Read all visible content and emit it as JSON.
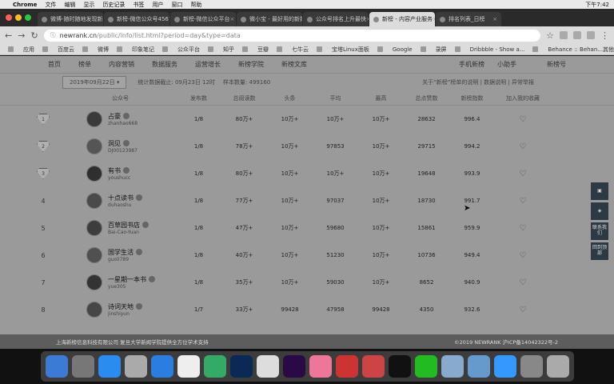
{
  "menubar": {
    "apple": "",
    "app": "Chrome",
    "items": [
      "文件",
      "编辑",
      "显示",
      "历史记录",
      "书签",
      "用户",
      "窗口",
      "帮助"
    ],
    "clock": "下午7:42"
  },
  "tabs": [
    {
      "label": "微博-随时随地发现新",
      "active": false
    },
    {
      "label": "新榜-微信公众号4567",
      "active": false
    },
    {
      "label": "新榜-微信公众平台",
      "active": false
    },
    {
      "label": "微小宝 - 最好用的新媒",
      "active": false
    },
    {
      "label": "公众号排名上升最快",
      "active": false
    },
    {
      "label": "新榜 - 内容产业服务",
      "active": true
    },
    {
      "label": "排名列表_日榜",
      "active": false
    }
  ],
  "address": {
    "host": "newrank.cn",
    "path": "/public/info/list.html?period=day&type=data"
  },
  "bookmarks": [
    "应用",
    "百度云",
    "微博",
    "印象笔记",
    "公众平台",
    "知乎",
    "豆瓣",
    "七牛云",
    "宝塔Linux面板",
    "Google",
    "录屏",
    "Dribbble - Show a...",
    "Behance :: Behan..."
  ],
  "bookmarks_other": "其他书签",
  "sitenav": {
    "items": [
      "首页",
      "榜单",
      "内容营销",
      "数据服务",
      "运营增长",
      "新榜学院",
      "新榜文库"
    ],
    "right": [
      "手机新榜",
      "小助手",
      "新榜号"
    ]
  },
  "filter": {
    "date": "2019年09月22日",
    "stat_time": "统计数据截止: 09月23日 12时",
    "sample": "样本数量: 499160",
    "links": "关于“新榜”榜单的说明 | 数据说明 | 异常举报"
  },
  "table": {
    "headers": [
      "",
      "公众号",
      "发布数",
      "总阅读数",
      "头条",
      "平均",
      "最高",
      "总点赞数",
      "新榜指数",
      "加入我的收藏"
    ],
    "rows": [
      {
        "rank": "1",
        "medal": true,
        "name": "占豪",
        "id": "zhanhao668",
        "posts": "1/8",
        "total": "80万+",
        "head": "10万+",
        "avg": "10万+",
        "max": "10万+",
        "likes": "28632",
        "index": "996.4"
      },
      {
        "rank": "2",
        "medal": true,
        "name": "洞见",
        "id": "DJ00123987",
        "posts": "1/8",
        "total": "78万+",
        "head": "10万+",
        "avg": "97853",
        "max": "10万+",
        "likes": "29715",
        "index": "994.2"
      },
      {
        "rank": "3",
        "medal": true,
        "name": "有书",
        "id": "youshucc",
        "posts": "1/8",
        "total": "80万+",
        "head": "10万+",
        "avg": "10万+",
        "max": "10万+",
        "likes": "19648",
        "index": "993.9"
      },
      {
        "rank": "4",
        "medal": false,
        "name": "十点读书",
        "id": "duhaoshu",
        "posts": "1/8",
        "total": "77万+",
        "head": "10万+",
        "avg": "97037",
        "max": "10万+",
        "likes": "18730",
        "index": "991.7"
      },
      {
        "rank": "5",
        "medal": false,
        "name": "百草园书店",
        "id": "Bai-Cao-Yuan",
        "posts": "1/8",
        "total": "47万+",
        "head": "10万+",
        "avg": "59680",
        "max": "10万+",
        "likes": "15861",
        "index": "959.9"
      },
      {
        "rank": "6",
        "medal": false,
        "name": "国学生活",
        "id": "guoli789",
        "posts": "1/8",
        "total": "40万+",
        "head": "10万+",
        "avg": "51230",
        "max": "10万+",
        "likes": "10736",
        "index": "949.4"
      },
      {
        "rank": "7",
        "medal": false,
        "name": "一星期一本书",
        "id": "yue305",
        "posts": "1/8",
        "total": "35万+",
        "head": "10万+",
        "avg": "59030",
        "max": "10万+",
        "likes": "8652",
        "index": "940.9"
      },
      {
        "rank": "8",
        "medal": false,
        "name": "诗词天地",
        "id": "jinshiyun",
        "posts": "1/7",
        "total": "33万+",
        "head": "99428",
        "avg": "47958",
        "max": "99428",
        "likes": "4350",
        "index": "932.6"
      }
    ],
    "fav_icon": "heart-outline-icon"
  },
  "float_buttons": [
    "",
    "",
    "联系我们",
    "回到顶部"
  ],
  "footer": {
    "left": "上海新榜信息科技有限公司    复旦大学新闻学院提供全方位学术支持",
    "right": "©2019 NEWRANK 沪ICP备14042322号-2"
  },
  "dock": [
    "Finder",
    "Launchpad",
    "App Store",
    "Photos",
    "Safari",
    "Calendar",
    "Feishu",
    "Photoshop",
    "Chrome",
    "Premiere",
    "Keynote",
    "Proxyman",
    "WPS",
    "QQ",
    "WeChat",
    "Preview",
    "Folder",
    "Baidu Netdisk",
    "Screenshot",
    "Trash"
  ],
  "colors": {
    "page_overlay": "#9a9a9a",
    "footer": "#5d5d5d",
    "float": "#2c3a44"
  }
}
